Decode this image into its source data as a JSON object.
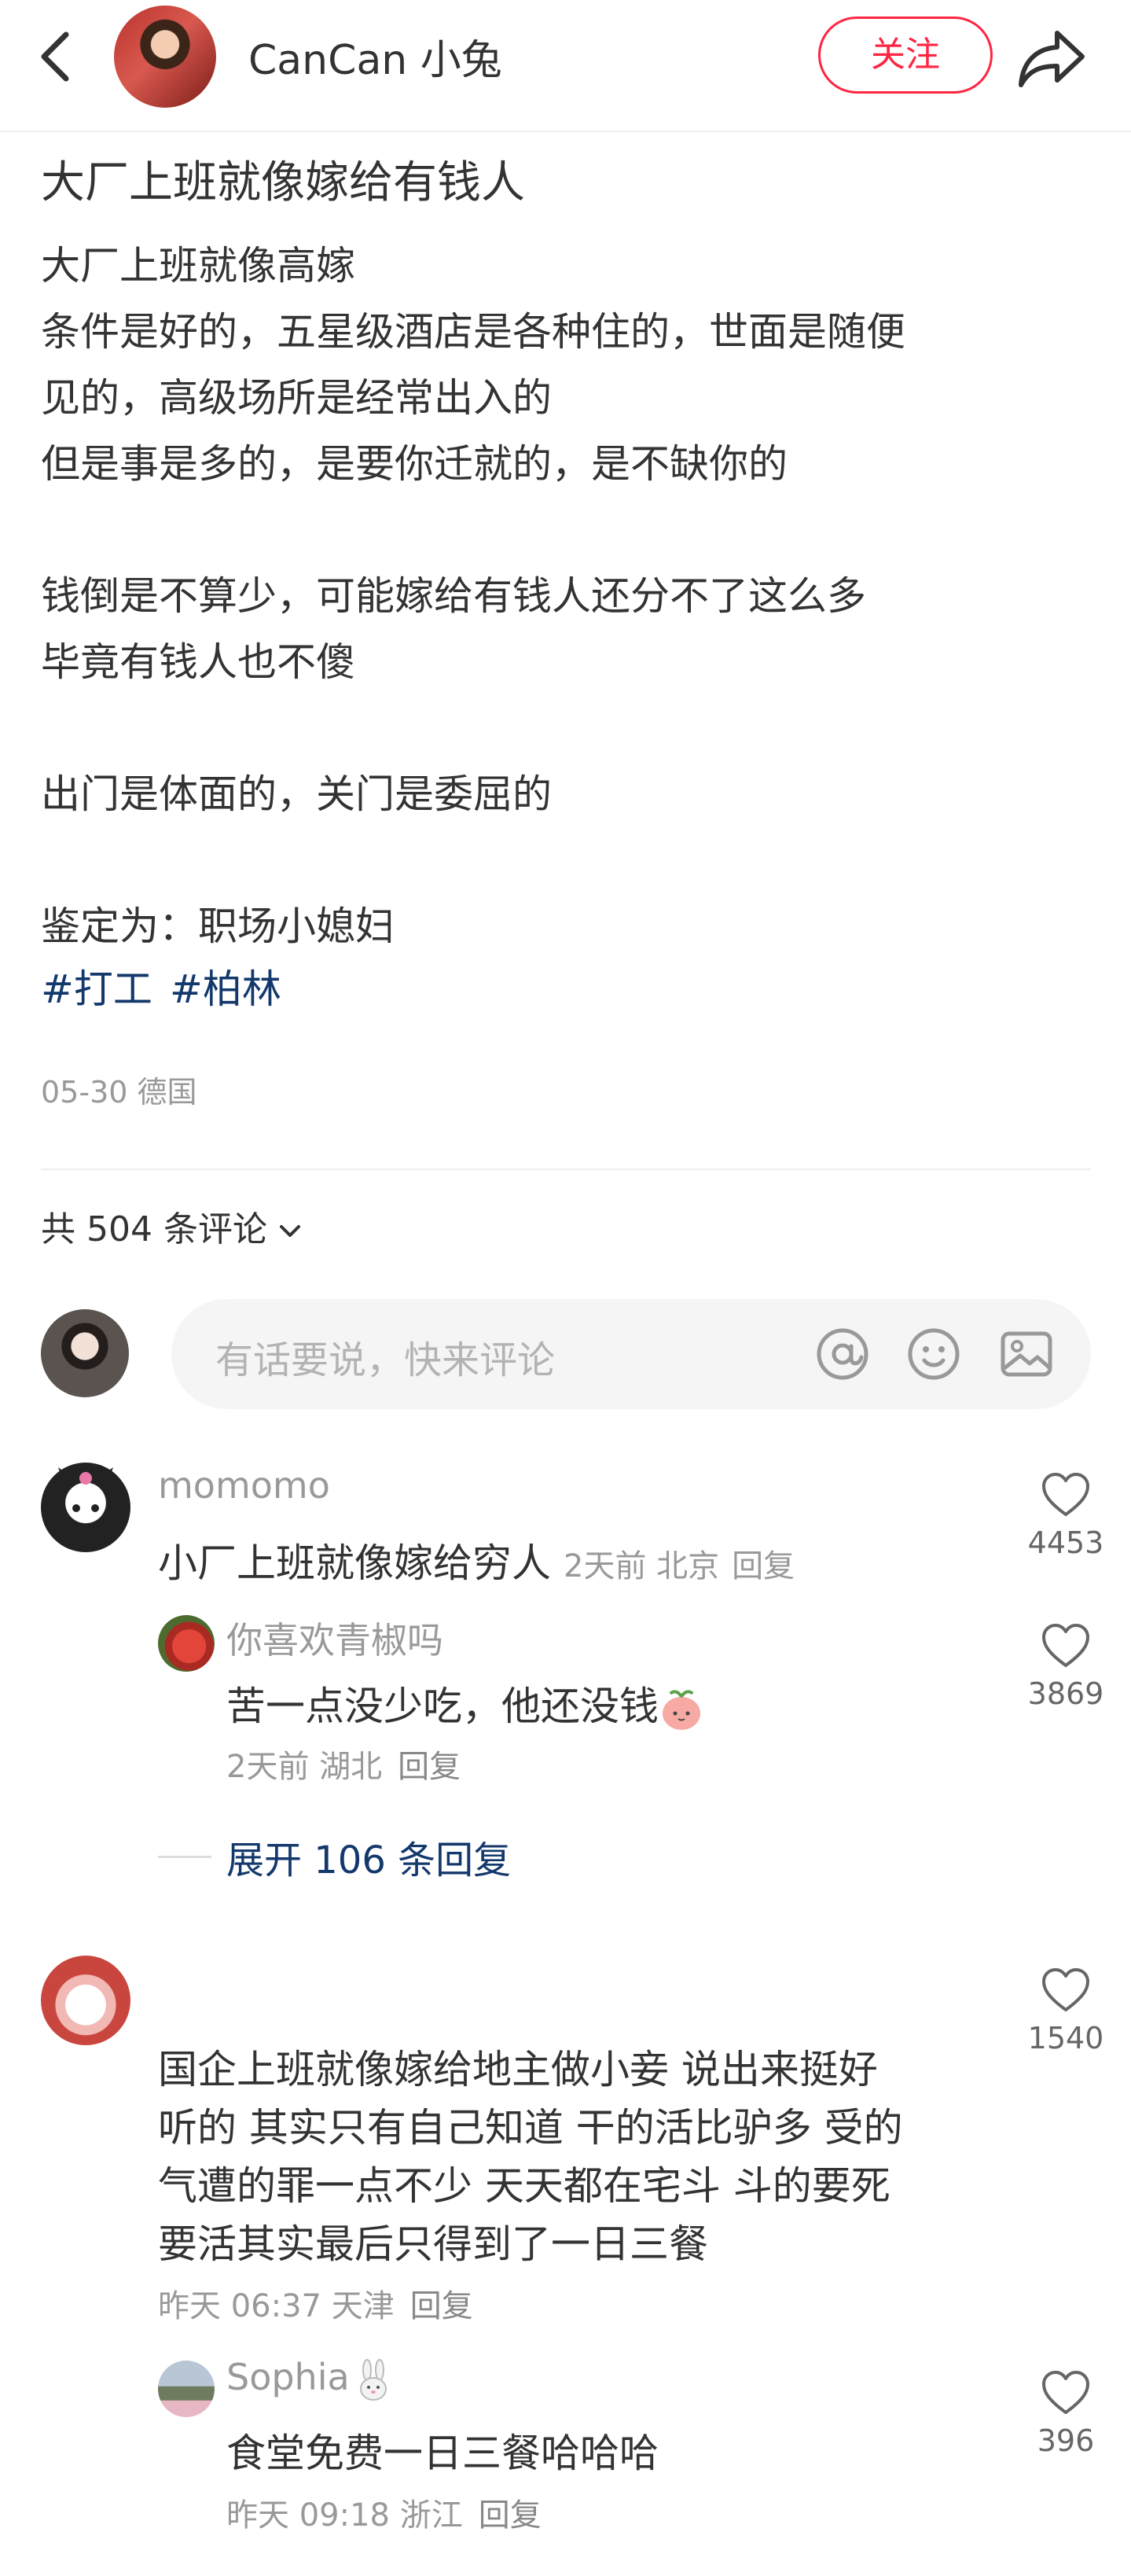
{
  "header": {
    "author_name": "CanCan 小兔",
    "follow_label": "关注",
    "back_icon": "chevron-left-icon",
    "share_icon": "share-arrow-icon"
  },
  "post": {
    "title": "大厂上班就像嫁给有钱人",
    "lines": [
      "大厂上班就像高嫁",
      "条件是好的，五星级酒店是各种住的，世面是随便",
      "见的，高级场所是经常出入的",
      "但是事是多的，是要你迁就的，是不缺你的",
      "钱倒是不算少，可能嫁给有钱人还分不了这么多",
      "毕竟有钱人也不傻",
      "出门是体面的，关门是委屈的",
      "鉴定为：职场小媳妇"
    ],
    "tags": [
      "#打工",
      "#柏林"
    ],
    "meta": "05-30 德国"
  },
  "comments_header": {
    "count_label": "共 504 条评论",
    "input_placeholder": "有话要说，快来评论",
    "icons": [
      "at-icon",
      "emoji-smile-icon",
      "image-icon"
    ]
  },
  "comments": [
    {
      "user": "momomo",
      "text": "小厂上班就像嫁给穷人",
      "meta": "2天前 北京",
      "reply_label": "回复",
      "likes": "4453",
      "replies": [
        {
          "user": "你喜欢青椒吗",
          "text": "苦一点没少吃，他还没钱",
          "meta": "2天前 湖北",
          "reply_label": "回复",
          "likes": "3869"
        }
      ],
      "expand_label": "展开 106 条回复"
    },
    {
      "user": "",
      "text_lines": [
        "国企上班就像嫁给地主做小妾 说出来挺好",
        "听的 其实只有自己知道 干的活比驴多 受的",
        "气遭的罪一点不少 天天都在宅斗 斗的要死",
        "要活其实最后只得到了一日三餐"
      ],
      "meta": "昨天 06:37 天津",
      "reply_label": "回复",
      "likes": "1540",
      "replies": [
        {
          "user": "Sophia",
          "text": "食堂免费一日三餐哈哈哈",
          "meta": "昨天 09:18 浙江",
          "reply_label": "回复",
          "likes": "396"
        }
      ]
    }
  ],
  "colors": {
    "accent_red": "#ff2442",
    "link_blue": "#13386c",
    "meta_gray": "#999999"
  }
}
